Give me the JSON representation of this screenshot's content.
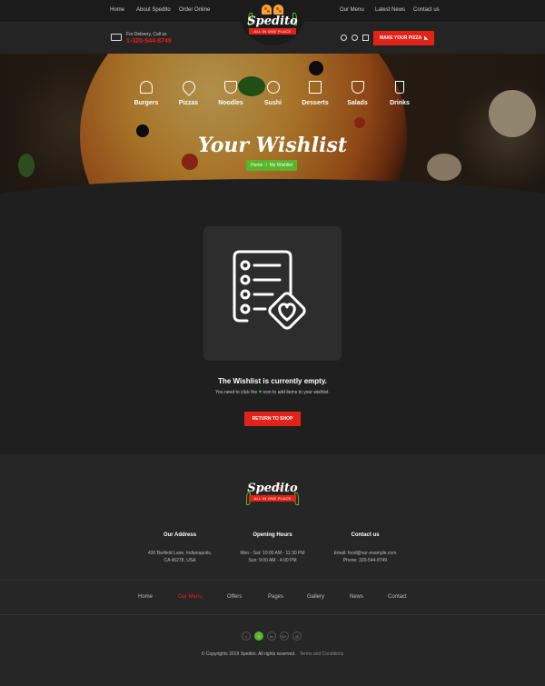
{
  "top_nav": {
    "left": [
      "Home",
      "About Spedito",
      "Order Online"
    ],
    "right": [
      "Our Menu",
      "Latest News",
      "Contact us"
    ]
  },
  "logo": {
    "name": "Spedito",
    "tagline": "ALL IN ONE PLACE"
  },
  "delivery": {
    "label": "For Delivery, Call us",
    "phone": "1-320-544-8749"
  },
  "header_cta": "MAKE YOUR PIZZA",
  "categories": [
    {
      "label": "Burgers",
      "icon": "burger-icon"
    },
    {
      "label": "Pizzas",
      "icon": "pizza-slice-icon"
    },
    {
      "label": "Noodles",
      "icon": "noodle-bowl-icon"
    },
    {
      "label": "Sushi",
      "icon": "sushi-icon"
    },
    {
      "label": "Desserts",
      "icon": "cake-icon"
    },
    {
      "label": "Salads",
      "icon": "salad-bowl-icon"
    },
    {
      "label": "Drinks",
      "icon": "drink-cup-icon"
    }
  ],
  "hero": {
    "title": "Your Wishlist",
    "breadcrumb": [
      "Home",
      "My Wishlist"
    ]
  },
  "wishlist": {
    "empty_title": "The Wishlist is currently empty.",
    "empty_pre": "You need to click the",
    "empty_post": "icon to add items to your wishlist.",
    "return_button": "RETURN TO SHOP"
  },
  "footer": {
    "address": {
      "title": "Our Address",
      "lines": [
        "430 Barfield Lane, Indianapolis,",
        "CA 46278, USA"
      ]
    },
    "hours": {
      "title": "Opening Hours",
      "lines": [
        "Mon - Sat: 10:00 AM - 11:30 PM",
        "Sun: 9:00 AM - 4:00 PM"
      ]
    },
    "contact": {
      "title": "Contact us",
      "lines": [
        "Email: food@our-example.com",
        "Phone: 320-544-8749"
      ]
    },
    "nav": [
      "Home",
      "Our Menu",
      "Offers",
      "Pages",
      "Gallery",
      "News",
      "Contact"
    ],
    "active_nav": "Our Menu",
    "socials": [
      "twitter",
      "facebook",
      "linkedin",
      "google-plus",
      "instagram"
    ],
    "copyright": "© Copyrights 2019 Spedito. All rights reserved.",
    "terms": "Terms and Conditions"
  },
  "colors": {
    "accent_red": "#e2231a",
    "accent_green": "#5ab52a",
    "background": "#1f1f1f"
  }
}
